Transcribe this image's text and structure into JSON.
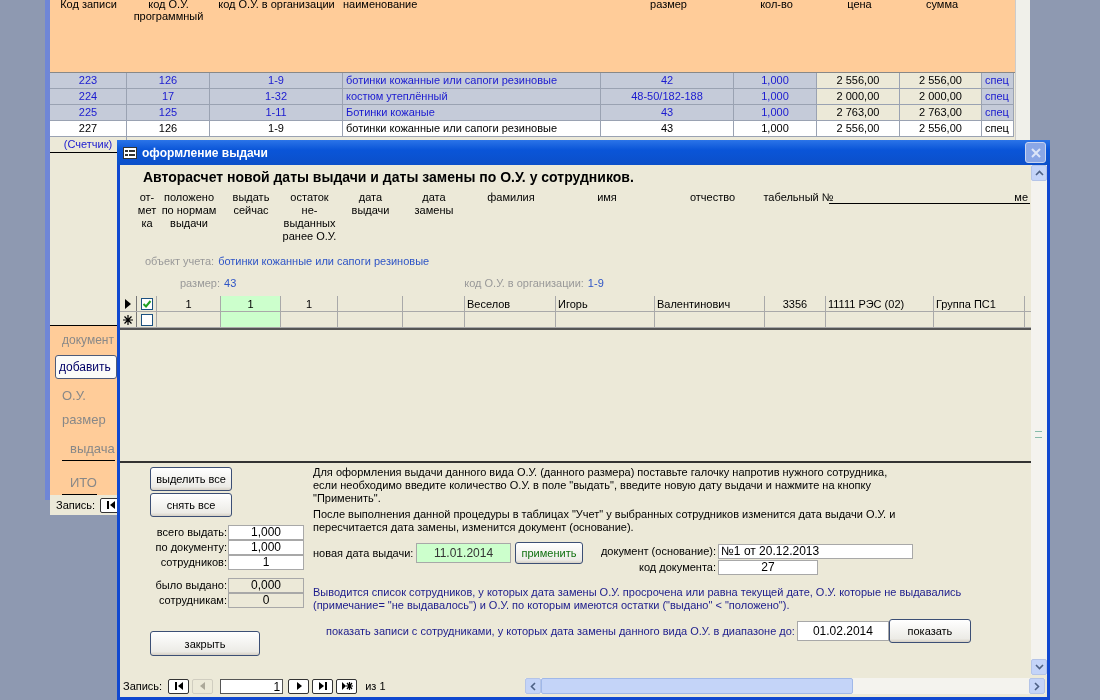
{
  "back_form": {
    "columns": [
      "Код записи",
      "код О.У.\nпрограммный",
      "код О.У. в организации",
      "наименование",
      "размер",
      "кол-во",
      "цена",
      "сумма"
    ],
    "rows": [
      {
        "selected": false,
        "cells": [
          "223",
          "126",
          "1-9",
          "ботинки кожанные или сапоги резиновые",
          "42",
          "1,000",
          "2 556,00",
          "2 556,00",
          "спец"
        ]
      },
      {
        "selected": false,
        "cells": [
          "224",
          "17",
          "1-32",
          "костюм утеплённый",
          "48-50/182-188",
          "1,000",
          "2 000,00",
          "2 000,00",
          "спец"
        ]
      },
      {
        "selected": false,
        "cells": [
          "225",
          "125",
          "1-11",
          "Ботинки кожаные",
          "43",
          "1,000",
          "2 763,00",
          "2 763,00",
          "спец"
        ]
      },
      {
        "selected": true,
        "cells": [
          "227",
          "126",
          "1-9",
          "ботинки кожанные или сапоги резиновые",
          "43",
          "1,000",
          "2 556,00",
          "2 556,00",
          "спец"
        ]
      }
    ],
    "counter_label": "(Счетчик)",
    "document_label": "документ",
    "add_button": "добавить",
    "side_labels": [
      "О.У.",
      "размер"
    ],
    "issue_label": "выдача",
    "total_label": "ИТО",
    "nav_label": "Запись:"
  },
  "dialog": {
    "title": "оформление выдачи",
    "heading": "Авторасчет новой даты выдачи и даты замены по О.У. у сотрудников.",
    "check_column": "от-\nмет\nка",
    "columns": [
      {
        "label": "положено\nпо нормам\nвыдачи",
        "highlight": false
      },
      {
        "label": "выдать\nсейчас",
        "highlight": true
      },
      {
        "label": "остаток\nне-\nвыданных\nранее О.У.",
        "highlight": false
      },
      {
        "label": "дата\nвыдачи",
        "highlight": false
      },
      {
        "label": "дата\nзамены",
        "highlight": false
      },
      {
        "label": "фамилия",
        "highlight": false
      },
      {
        "label": "имя",
        "highlight": false
      },
      {
        "label": "отчество",
        "highlight": false
      },
      {
        "label": "табельный №",
        "highlight": false
      }
    ],
    "cut_header": "ме",
    "object_label": "объект учета:",
    "object_value": "ботинки кожанные или сапоги резиновые",
    "size_label": "размер:",
    "size_value": "43",
    "org_code_label": "код О.У. в организации:",
    "org_code_value": "1-9",
    "rows": [
      {
        "current": true,
        "new_record": false,
        "checked": true,
        "cells": [
          "1",
          "1",
          "1",
          "",
          "",
          "Веселов",
          "Игорь",
          "Валентинович",
          "3356",
          "11111 РЭС (02)",
          "Группа ПС1"
        ]
      },
      {
        "current": false,
        "new_record": true,
        "checked": false,
        "cells": [
          "",
          "",
          "",
          "",
          "",
          "",
          "",
          "",
          "",
          "",
          ""
        ]
      }
    ],
    "select_all_button": "выделить все",
    "clear_all_button": "снять все",
    "totals": [
      {
        "label": "всего выдать:",
        "value": "1,000",
        "locked": false
      },
      {
        "label": "по документу:",
        "value": "1,000",
        "locked": false
      },
      {
        "label": "сотрудников:",
        "value": "1",
        "locked": false
      }
    ],
    "issued": [
      {
        "label": "было выдано:",
        "value": "0,000",
        "locked": true
      },
      {
        "label": "сотрудникам:",
        "value": "0",
        "locked": true
      }
    ],
    "close_button": "закрыть",
    "instructions": [
      "Для оформления выдачи данного вида О.У. (данного размера) поставьте галочку напротив нужного сотрудника, если необходимо введите количество О.У. в поле \"выдать\", введите новую дату выдачи и нажмите на кнопку \"Применить\".",
      "После выполнения данной процедуры в таблицах \"Учет\" у выбранных сотрудников изменится дата выдачи О.У. и пересчитается дата замены, изменится документ (основание)."
    ],
    "new_date_label": "новая дата выдачи:",
    "new_date": "11.01.2014",
    "apply_button": "применить",
    "document_label": "документ (основание):",
    "document_value": "№1 от 20.12.2013",
    "doc_code_label": "код документа:",
    "doc_code_value": "27",
    "note": "Выводится список сотрудников, у которых дата замены О.У. просрочена или равна текущей дате, О.У. которые не выдавались (примечание= \"не выдавалось\") и О.У. по которым имеются остатки (\"выдано\" < \"положено\").",
    "range_label": "показать записи с сотрудниками, у которых дата замены данного вида О.У. в диапазоне до:",
    "range_date": "01.02.2014",
    "show_button": "показать",
    "nav": {
      "label": "Запись:",
      "record": "1",
      "of": "из 1",
      "buttons": [
        {
          "kind": "first",
          "disabled": false
        },
        {
          "kind": "prev",
          "disabled": true
        },
        {
          "kind": "next",
          "disabled": false
        },
        {
          "kind": "last",
          "disabled": false
        },
        {
          "kind": "new",
          "disabled": false
        }
      ]
    }
  }
}
